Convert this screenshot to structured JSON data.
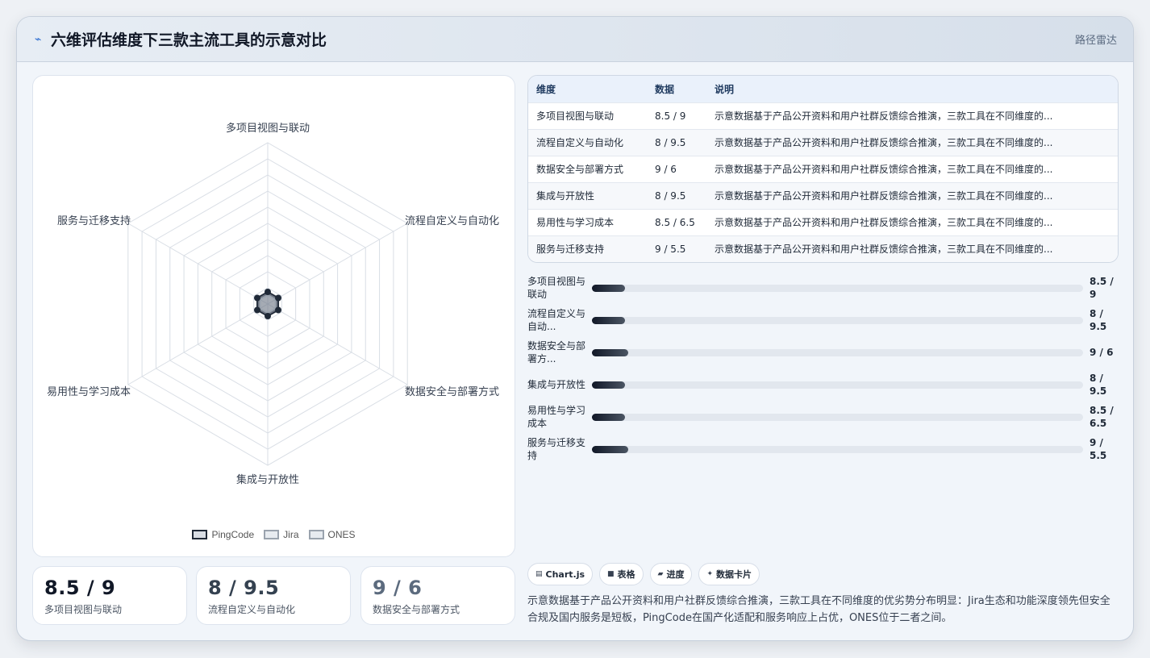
{
  "header": {
    "icon": "bolt-icon",
    "title": "六维评估维度下三款主流工具的示意对比",
    "tag": "路径雷达"
  },
  "chart_data": {
    "type": "radar",
    "axes": [
      "多项目视图与联动",
      "流程自定义与自动化",
      "数据安全与部署方式",
      "集成与开放性",
      "易用性与学习成本",
      "服务与迁移支持"
    ],
    "series": [
      {
        "name": "PingCode"
      },
      {
        "name": "Jira"
      },
      {
        "name": "ONES"
      }
    ],
    "grid_rings": 10,
    "legend_position": "bottom"
  },
  "stats": [
    {
      "value": "8.5 / 9",
      "label": "多项目视图与联动"
    },
    {
      "value": "8 / 9.5",
      "label": "流程自定义与自动化"
    },
    {
      "value": "9 / 6",
      "label": "数据安全与部署方式"
    }
  ],
  "table": {
    "headers": [
      "维度",
      "数据",
      "说明"
    ],
    "rows": [
      {
        "dim": "多项目视图与联动",
        "data": "8.5 / 9",
        "desc": "示意数据基于产品公开资料和用户社群反馈综合推演，三款工具在不同维度的..."
      },
      {
        "dim": "流程自定义与自动化",
        "data": "8 / 9.5",
        "desc": "示意数据基于产品公开资料和用户社群反馈综合推演，三款工具在不同维度的..."
      },
      {
        "dim": "数据安全与部署方式",
        "data": "9 / 6",
        "desc": "示意数据基于产品公开资料和用户社群反馈综合推演，三款工具在不同维度的..."
      },
      {
        "dim": "集成与开放性",
        "data": "8 / 9.5",
        "desc": "示意数据基于产品公开资料和用户社群反馈综合推演，三款工具在不同维度的..."
      },
      {
        "dim": "易用性与学习成本",
        "data": "8.5 / 6.5",
        "desc": "示意数据基于产品公开资料和用户社群反馈综合推演，三款工具在不同维度的..."
      },
      {
        "dim": "服务与迁移支持",
        "data": "9 / 5.5",
        "desc": "示意数据基于产品公开资料和用户社群反馈综合推演，三款工具在不同维度的..."
      }
    ]
  },
  "progress": [
    {
      "label": "多项目视图与联动",
      "value": "8.5 / 9",
      "fill_pct": 6.7
    },
    {
      "label": "流程自定义与自动...",
      "value": "8 / 9.5",
      "fill_pct": 6.7
    },
    {
      "label": "数据安全与部署方...",
      "value": "9 / 6",
      "fill_pct": 7.4
    },
    {
      "label": "集成与开放性",
      "value": "8 / 9.5",
      "fill_pct": 6.7
    },
    {
      "label": "易用性与学习成本",
      "value": "8.5 / 6.5",
      "fill_pct": 6.7
    },
    {
      "label": "服务与迁移支持",
      "value": "9 / 5.5",
      "fill_pct": 7.4
    }
  ],
  "chips": [
    {
      "icon": "chart-icon",
      "glyph": "▤",
      "label": "Chart.js"
    },
    {
      "icon": "table-icon",
      "glyph": "■",
      "label": "表格"
    },
    {
      "icon": "progress-icon",
      "glyph": "▰",
      "label": "进度"
    },
    {
      "icon": "sparkle-icon",
      "glyph": "✦",
      "label": "数据卡片"
    }
  ],
  "summary": "示意数据基于产品公开资料和用户社群反馈综合推演，三款工具在不同维度的优劣势分布明显：Jira生态和功能深度领先但安全合规及国内服务是短板，PingCode在国产化适配和服务响应上占优，ONES位于二者之间。",
  "colors": {
    "accent": "#2f6fd1",
    "series_dark": "#1f2937",
    "grid": "#d9dee5"
  }
}
